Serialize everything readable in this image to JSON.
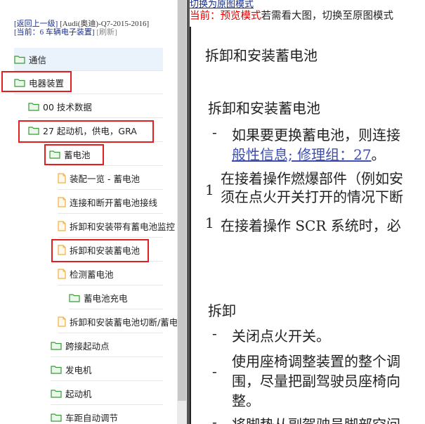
{
  "header": {
    "back_link": "[返回上一级]",
    "brand": "[Audi(奥迪)-Q7-2015-2016]",
    "current_label": "[当前：",
    "current_value": "6 车辆电子装置]",
    "refresh": "[刷新]"
  },
  "tree": [
    {
      "label": "通信",
      "type": "folder",
      "selected": true
    },
    {
      "label": "电器装置",
      "type": "folder"
    },
    {
      "label": "00 技术数据",
      "type": "folder"
    },
    {
      "label": "27 起动机，供电，GRA",
      "type": "folder"
    },
    {
      "label": "蓄电池",
      "type": "folder"
    },
    {
      "label": "装配一览 - 蓄电池",
      "type": "file"
    },
    {
      "label": "连接和断开蓄电池接线",
      "type": "file"
    },
    {
      "label": "拆卸和安装带有蓄电池监控",
      "type": "file"
    },
    {
      "label": "拆卸和安装蓄电池",
      "type": "file"
    },
    {
      "label": "检测蓄电池",
      "type": "file"
    },
    {
      "label": "蓄电池充电",
      "type": "folder"
    },
    {
      "label": "拆卸和安装蓄电池切断/蓄电",
      "type": "file"
    },
    {
      "label": "跨接起动点",
      "type": "folder"
    },
    {
      "label": "发电机",
      "type": "folder"
    },
    {
      "label": "起动机",
      "type": "folder"
    },
    {
      "label": "车距自动调节",
      "type": "folder"
    }
  ],
  "viewer": {
    "switch_link": "切换为原图模式",
    "mode_prefix": "当前：",
    "mode_value": "预览模式",
    "mode_hint": "若需看大图，切换至原图模式",
    "doc_title": "拆卸和安装蓄电池",
    "section_title": "拆卸和安装蓄电池",
    "line1": "如果要更换蓄电池，则连接",
    "line1_link": "般性信息; 修理组：27",
    "line1_end": "。",
    "num1": "1",
    "line2a": "在接着操作燃爆部件（例如安",
    "line2b": "须在点火开关打开的情况下断",
    "num2": "1",
    "line3": "在接着操作 SCR 系统时，必",
    "removal_title": "拆卸",
    "step1": "关闭点火开关。",
    "step2a": "使用座椅调整装置的整个调",
    "step2b": "围，尽量把副驾驶员座椅向",
    "step2c": "整。",
    "step3": "将脚垫从副驾驶员脚部空间",
    "dash": "-"
  },
  "colors": {
    "highlight_box": "#e02020",
    "folder_green": "#3a9a3a",
    "file_orange": "#f0b040",
    "link_blue": "#3d4eb5",
    "mode_red": "#d00000"
  }
}
